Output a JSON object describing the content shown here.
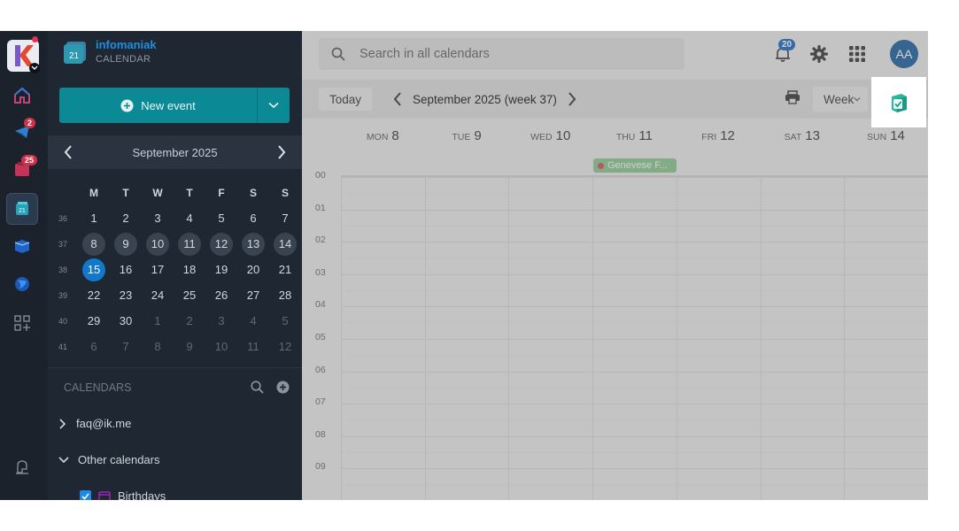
{
  "rail": {
    "home_badge": "",
    "mail_badge": "2",
    "tasks_badge": "25"
  },
  "brand": {
    "name": "infomaniak",
    "product": "CALENDAR"
  },
  "new_event_label": "New event",
  "mini_calendar": {
    "title": "September  2025",
    "weekday_headers": [
      "M",
      "T",
      "W",
      "T",
      "F",
      "S",
      "S"
    ],
    "weeks": [
      {
        "wk": "36",
        "days": [
          "1",
          "2",
          "3",
          "4",
          "5",
          "6",
          "7"
        ]
      },
      {
        "wk": "37",
        "days": [
          "8",
          "9",
          "10",
          "11",
          "12",
          "13",
          "14"
        ]
      },
      {
        "wk": "38",
        "days": [
          "15",
          "16",
          "17",
          "18",
          "19",
          "20",
          "21"
        ]
      },
      {
        "wk": "39",
        "days": [
          "22",
          "23",
          "24",
          "25",
          "26",
          "27",
          "28"
        ]
      },
      {
        "wk": "40",
        "days": [
          "29",
          "30",
          "1",
          "2",
          "3",
          "4",
          "5"
        ]
      },
      {
        "wk": "41",
        "days": [
          "6",
          "7",
          "8",
          "9",
          "10",
          "11",
          "12"
        ]
      }
    ]
  },
  "calendars": {
    "header": "CALENDARS",
    "items": [
      {
        "label": "faq@ik.me"
      },
      {
        "label": "Other calendars"
      },
      {
        "label": "Birthdays"
      }
    ]
  },
  "search": {
    "placeholder": "Search in all calendars"
  },
  "notifications": {
    "count": "20"
  },
  "user": {
    "initials": "AA"
  },
  "toolbar": {
    "today_label": "Today",
    "range_label": "September 2025 (week 37)",
    "view_label": "Week"
  },
  "week_days": [
    {
      "name": "MON",
      "date": "8"
    },
    {
      "name": "TUE",
      "date": "9"
    },
    {
      "name": "WED",
      "date": "10"
    },
    {
      "name": "THU",
      "date": "11"
    },
    {
      "name": "FRI",
      "date": "12"
    },
    {
      "name": "SAT",
      "date": "13"
    },
    {
      "name": "SUN",
      "date": "14"
    }
  ],
  "all_day_event": {
    "title": "Genevese F..."
  },
  "hours": [
    "00",
    "01",
    "02",
    "03",
    "04",
    "05",
    "06",
    "07",
    "08",
    "09"
  ],
  "colors": {
    "accent": "#0b8a96",
    "today": "#1278c9",
    "event": "#86c58c",
    "brand": "#1e8fe0"
  }
}
